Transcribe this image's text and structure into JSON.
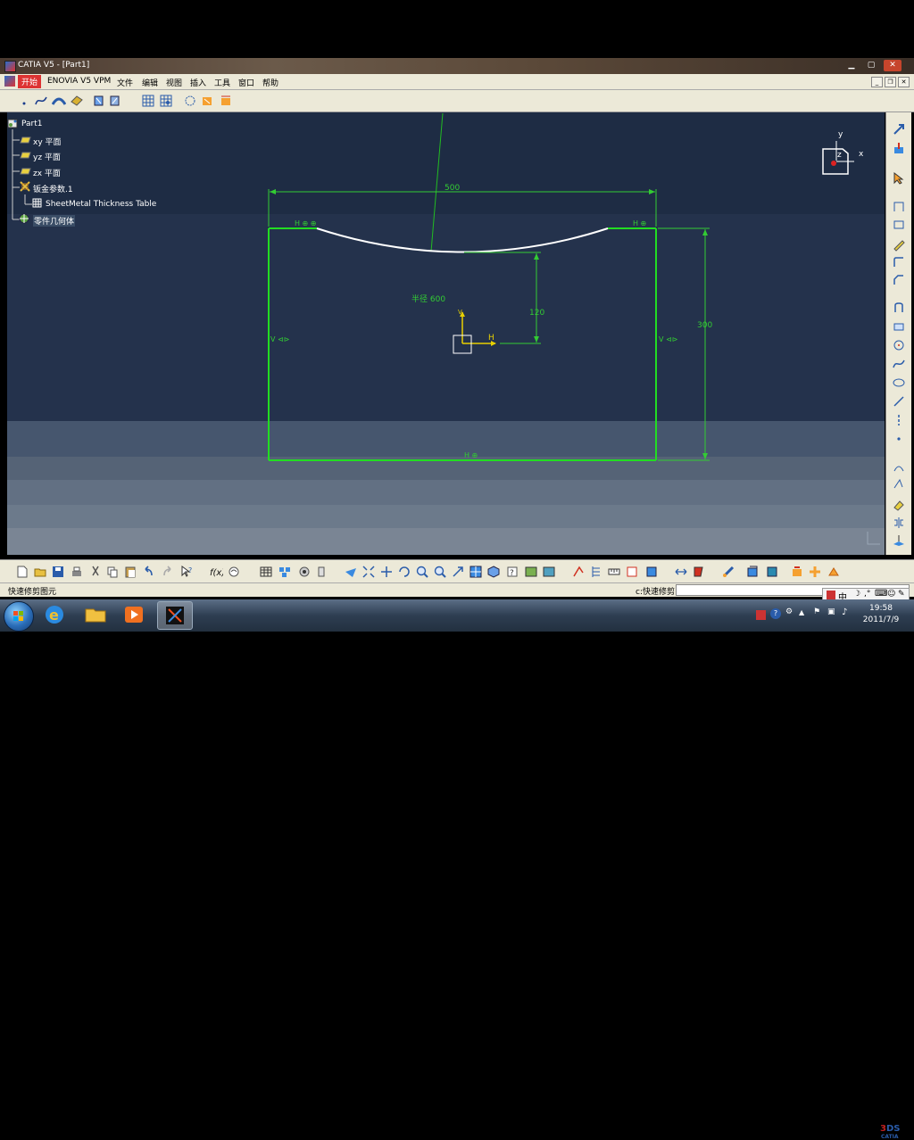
{
  "window": {
    "title": "CATIA V5 - [Part1]"
  },
  "menu": {
    "start": "开始",
    "items": [
      "ENOVIA V5 VPM",
      "文件",
      "编辑",
      "视图",
      "插入",
      "工具",
      "窗口",
      "帮助"
    ]
  },
  "tree": {
    "root": "Part1",
    "items": [
      "xy 平面",
      "yz 平面",
      "zx 平面",
      "钣金参数.1",
      "SheetMetal Thickness Table",
      "零件几何体"
    ]
  },
  "sketch": {
    "dim_width": "500",
    "dim_height": "300",
    "dim_offset": "120",
    "dim_radius": "半径 600",
    "axis_h": "H",
    "axis_v": "V",
    "constraint_h_left": "H ⊕ ⊕",
    "constraint_h_right": "H ⊕",
    "constraint_v_left": "V ⊲⊳",
    "constraint_v_right": "V ⊲⊳",
    "constraint_bottom": "H ⊕",
    "compass": {
      "x": "x",
      "y": "y",
      "z": "z"
    }
  },
  "status": {
    "left": "快速修剪图元",
    "cmd_label": "c:快速修剪",
    "cmd_value": ""
  },
  "ime": {
    "label": "中"
  },
  "clock": {
    "time": "19:58",
    "date": "2011/7/9"
  },
  "colors": {
    "sketch_green": "#22dd22",
    "arc_white": "#ffffff",
    "dim_green": "#33cc33",
    "axis_yellow": "#e8d000"
  }
}
